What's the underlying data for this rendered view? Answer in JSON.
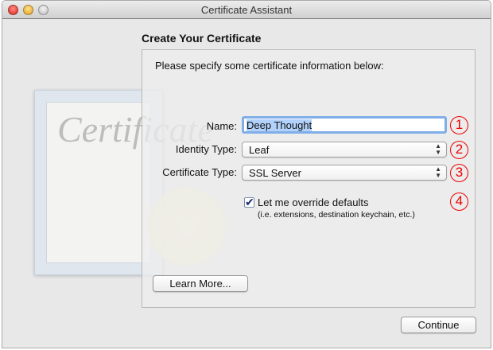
{
  "window": {
    "title": "Certificate Assistant"
  },
  "heading": "Create Your Certificate",
  "intro": "Please specify some certificate information below:",
  "name": {
    "label": "Name:",
    "value": "Deep Thought"
  },
  "identity_type": {
    "label": "Identity Type:",
    "value": "Leaf"
  },
  "certificate_type": {
    "label": "Certificate Type:",
    "value": "SSL Server"
  },
  "override": {
    "label": "Let me override defaults",
    "hint": "(i.e. extensions, destination keychain, etc.)",
    "checked": true
  },
  "annotations": [
    "1",
    "2",
    "3",
    "4"
  ],
  "buttons": {
    "learn_more": "Learn More...",
    "continue": "Continue"
  },
  "illustration": {
    "text": "Certificate"
  }
}
